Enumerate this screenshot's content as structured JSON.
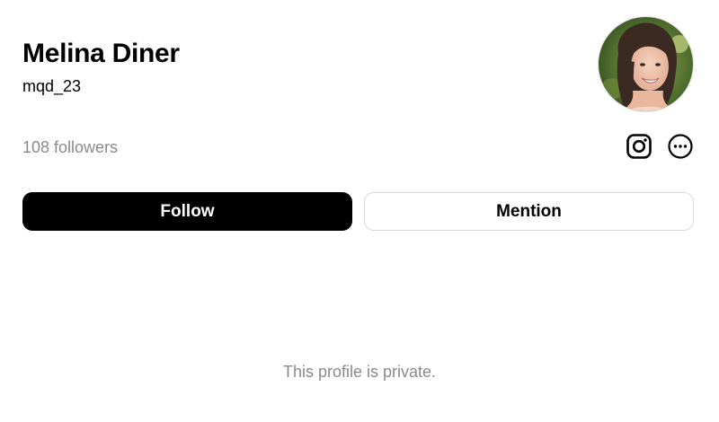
{
  "profile": {
    "display_name": "Melina Diner",
    "username": "mqd_23",
    "followers_text": "108 followers",
    "avatar_alt": "Profile photo"
  },
  "icons": {
    "instagram": "instagram-icon",
    "more": "more-options-icon"
  },
  "actions": {
    "follow_label": "Follow",
    "mention_label": "Mention"
  },
  "body": {
    "private_notice": "This profile is private."
  },
  "colors": {
    "primary_button_bg": "#000000",
    "primary_button_text": "#ffffff",
    "muted_text": "#8a8a8a",
    "outline_border": "#d9d9d9"
  }
}
